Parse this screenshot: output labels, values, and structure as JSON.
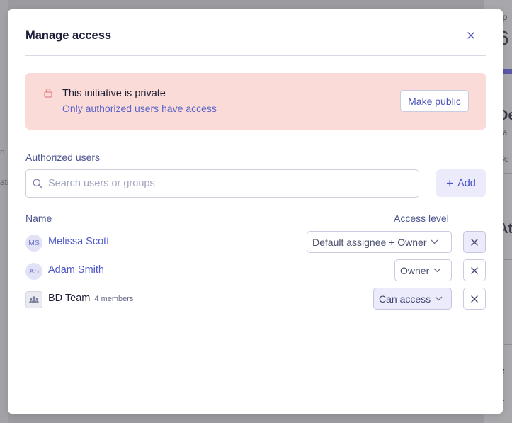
{
  "modal": {
    "title": "Manage access",
    "close_icon": "close-icon"
  },
  "banner": {
    "icon": "lock-icon",
    "title": "This initiative is private",
    "subtitle": "Only authorized users have access",
    "make_public_label": "Make public",
    "accent_color": "#fadbd8"
  },
  "authorized": {
    "section_label": "Authorized users",
    "search_placeholder": "Search users or groups",
    "search_value": "",
    "add_label": "Add"
  },
  "table": {
    "col_name": "Name",
    "col_access": "Access level",
    "rows": [
      {
        "initials": "MS",
        "name": "Melissa Scott",
        "access": "Default assignee + Owner",
        "type": "user"
      },
      {
        "initials": "AS",
        "name": "Adam Smith",
        "access": "Owner",
        "type": "user"
      },
      {
        "name": "BD Team",
        "members": "4 members",
        "access": "Can access",
        "type": "group"
      }
    ]
  },
  "background": {
    "left_texts": [
      "n",
      "ati"
    ],
    "right_texts": [
      "op",
      "6",
      "De",
      "ga",
      "Se",
      "At",
      "F",
      "T"
    ]
  },
  "colors": {
    "primary": "#4f57c9",
    "title": "#1c1e3a",
    "muted": "#4e5690"
  }
}
